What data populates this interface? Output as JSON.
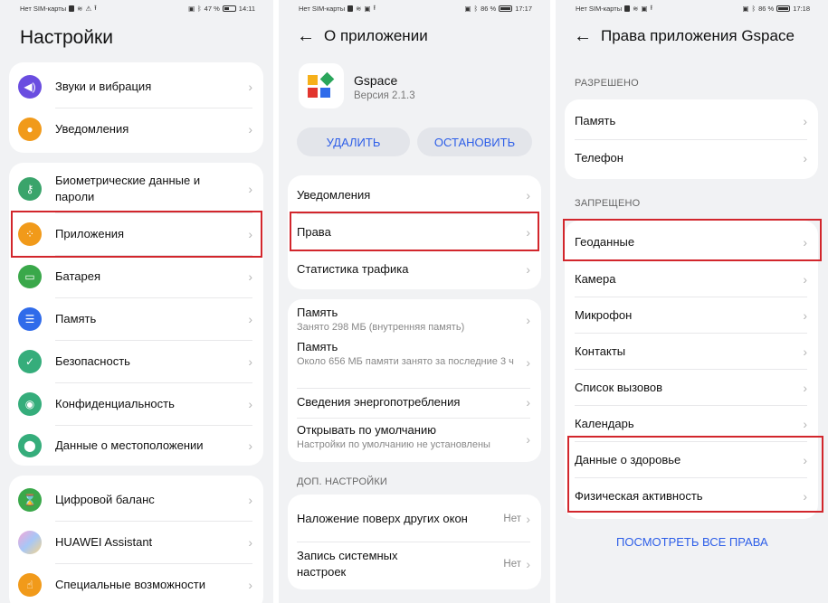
{
  "status": {
    "carrier": "Нет SIM-карты",
    "p1": {
      "battery": "47 %",
      "time": "14:11"
    },
    "p2": {
      "battery": "86 %",
      "time": "17:17"
    },
    "p3": {
      "battery": "86 %",
      "time": "17:18"
    }
  },
  "colors": {
    "accent": "#2d5ee8",
    "highlight": "#d2262c",
    "background": "#f1f2f4"
  },
  "settings": {
    "title": "Настройки",
    "group1": [
      {
        "label": "Звуки и вибрация",
        "icon": "speaker-icon",
        "color": "#6a4de0"
      },
      {
        "label": "Уведомления",
        "icon": "bell-icon",
        "color": "#f19a1a"
      }
    ],
    "group2": [
      {
        "label": "Биометрические данные и пароли",
        "icon": "key-icon",
        "color": "#3aa46b"
      },
      {
        "label": "Приложения",
        "icon": "apps-icon",
        "color": "#f19a1a"
      },
      {
        "label": "Батарея",
        "icon": "battery-icon",
        "color": "#3aa84a"
      },
      {
        "label": "Память",
        "icon": "storage-icon",
        "color": "#2f6bea"
      },
      {
        "label": "Безопасность",
        "icon": "shield-icon",
        "color": "#35ad7b"
      },
      {
        "label": "Конфиденциальность",
        "icon": "privacy-icon",
        "color": "#35ad7b"
      },
      {
        "label": "Данные о местоположении",
        "icon": "location-icon",
        "color": "#35ad7b"
      }
    ],
    "group3": [
      {
        "label": "Цифровой баланс",
        "icon": "hourglass-icon",
        "color": "#3aa84a"
      },
      {
        "label": "HUAWEI Assistant",
        "icon": "assistant-icon",
        "color": "#c86ee6"
      },
      {
        "label": "Специальные возможности",
        "icon": "accessibility-icon",
        "color": "#f19a1a"
      }
    ]
  },
  "app_info": {
    "title": "О приложении",
    "app_name": "Gspace",
    "version": "Версия 2.1.3",
    "delete_label": "УДАЛИТЬ",
    "stop_label": "ОСТАНОВИТЬ",
    "group1": [
      "Уведомления",
      "Права",
      "Статистика трафика"
    ],
    "memory1": {
      "label": "Память",
      "sub": "Занято 298 МБ (внутренняя память)"
    },
    "memory2": {
      "label": "Память",
      "sub": "Около 656 МБ памяти занято за последние 3 ч"
    },
    "energy": "Сведения энергопотребления",
    "defaults": {
      "label": "Открывать по умолчанию",
      "sub": "Настройки по умолчанию не установлены"
    },
    "extra_section": "ДОП. НАСТРОЙКИ",
    "overlay": {
      "label": "Наложение поверх других окон",
      "value": "Нет"
    },
    "write_settings": {
      "label": "Запись системных настроек",
      "value": "Нет"
    }
  },
  "permissions": {
    "title": "Права приложения Gspace",
    "allowed_label": "РАЗРЕШЕНО",
    "allowed": [
      "Память",
      "Телефон"
    ],
    "denied_label": "ЗАПРЕЩЕНО",
    "denied": [
      "Геоданные",
      "Камера",
      "Микрофон",
      "Контакты",
      "Список вызовов",
      "Календарь",
      "Данные о здоровье",
      "Физическая активность"
    ],
    "view_all": "ПОСМОТРЕТЬ ВСЕ ПРАВА"
  }
}
